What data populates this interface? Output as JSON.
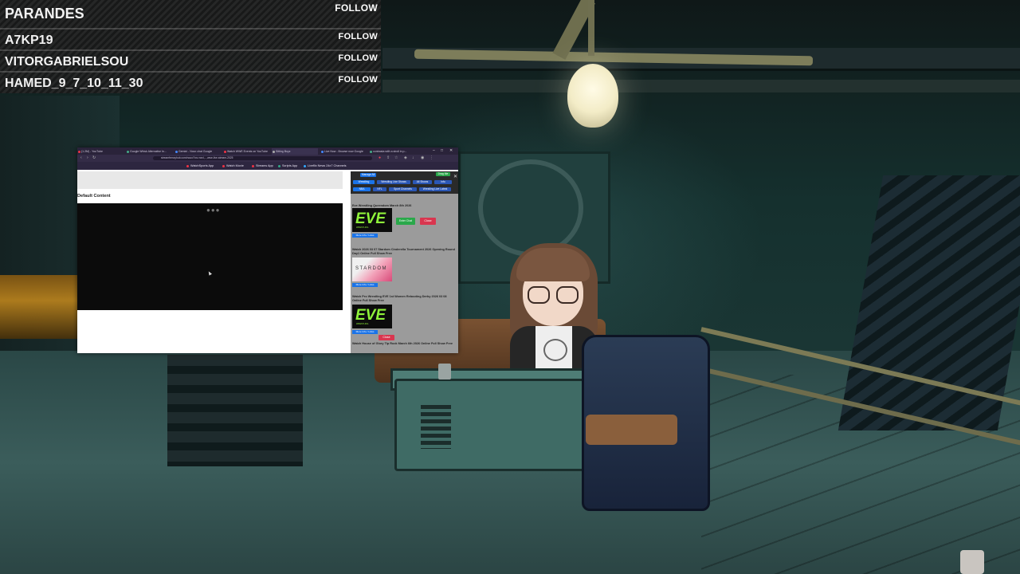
{
  "followers": [
    {
      "name": "PARANDES",
      "action": "FOLLOW"
    },
    {
      "name": "A7KP19",
      "action": "FOLLOW"
    },
    {
      "name": "VITORGABRIELSOU",
      "action": "FOLLOW"
    },
    {
      "name": "HAMED_9_7_10_11_30",
      "action": "FOLLOW"
    }
  ],
  "browser": {
    "tabs": [
      {
        "title": "(1.2M) - YouTube",
        "active": false
      },
      {
        "title": "Google Whisk Alternative In...",
        "active": false
      },
      {
        "title": "Gemini - Novo chat Google",
        "active": false
      },
      {
        "title": "Watch WWE Events on YouTube",
        "active": false
      },
      {
        "title": "Sitting Boyz",
        "active": true
      },
      {
        "title": "Live Now - Browse now Google",
        "active": false
      },
      {
        "title": "contrasta with a stroll in p...",
        "active": false
      }
    ],
    "url": "streamfrenzyhub.com/nouv/?cs=nxxl,...,wwe-live-stream-2025",
    "bookmarks": [
      {
        "label": "WatchSports App",
        "color": "#e34"
      },
      {
        "label": "Watch Movie",
        "color": "#e34"
      },
      {
        "label": "Streams App",
        "color": "#e34"
      },
      {
        "label": "Scripts App",
        "color": "#3a8"
      },
      {
        "label": "Liveflix News 24x7 Channels",
        "color": "#3af"
      }
    ],
    "page": {
      "default_content": "Default Content",
      "loading": "●●●",
      "sidebar": {
        "nav_top": [
          "Manage All",
          "Drag Me"
        ],
        "nav_rows": [
          [
            "Wrestling",
            "Wrestling Live Shows",
            "All Shows",
            "Info"
          ],
          [
            "NBA",
            "NFL",
            "Sport Channels",
            "Wrestling Live Latest"
          ]
        ],
        "events": [
          {
            "title": "Eve Wrestling Queendom March 8th 2026",
            "thumb": "eve",
            "thumb_text": "EVE",
            "thumb_sub": "WRESTLING",
            "more": "More Info / Links",
            "enter": "Enter Chat",
            "close": "Close"
          },
          {
            "title": "Watch 2026 03 07 Stardom Cinderella Tournament 2026 Opening Round Day1 Online Full Show Free",
            "thumb": "stardom",
            "thumb_text": "STARDOM",
            "more": "More Info / Links"
          },
          {
            "title": "Watch Pro Wrestling EVE 1st Women Rebooting Derby 2026 03 08 Online Full Show Free",
            "thumb": "eve",
            "thumb_text": "EVE",
            "thumb_sub": "WRESTLING",
            "more": "More Info / Links",
            "close": "Close"
          },
          {
            "title": "Watch House of Glory Tip Rock March 6th 2026 Online Full Show Free",
            "thumb": "none"
          }
        ]
      }
    }
  }
}
